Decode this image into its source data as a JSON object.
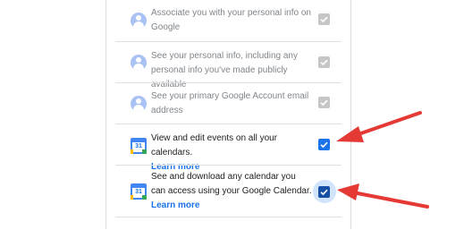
{
  "permissions": [
    {
      "text": "Associate you with your personal info on Google",
      "icon": "account-avatar-icon",
      "checked": true,
      "enabled": false
    },
    {
      "text": "See your personal info, including any personal info you've made publicly available",
      "icon": "account-avatar-icon",
      "checked": true,
      "enabled": false
    },
    {
      "text": "See your primary Google Account email address",
      "icon": "account-avatar-icon",
      "checked": true,
      "enabled": false
    },
    {
      "text": "View and edit events on all your calendars.",
      "link": "Learn more",
      "icon": "google-calendar-icon",
      "checked": true,
      "enabled": true
    },
    {
      "text": "See and download any calendar you can access using your Google Calendar.",
      "link": "Learn more",
      "icon": "google-calendar-icon",
      "checked": true,
      "enabled": true,
      "focused": true
    }
  ],
  "calendar_icon_label": "31",
  "colors": {
    "check_blue": "#1a73e8",
    "check_focused": "#174ea6",
    "check_disabled": "#c6c6c6",
    "arrow_red": "#e53935",
    "link": "#1a73e8"
  }
}
